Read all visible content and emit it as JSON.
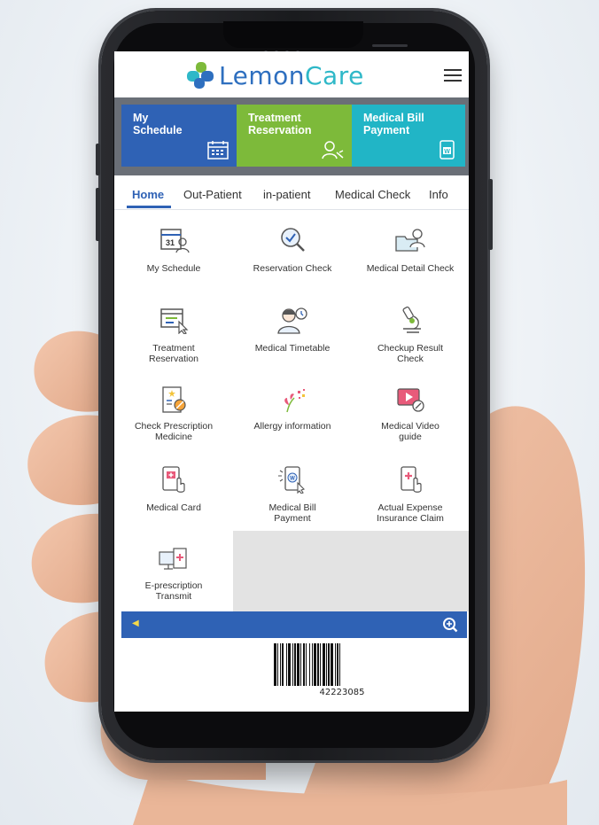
{
  "app": {
    "logo_lemon": "Lemon",
    "logo_care": "Care",
    "menu_icon": "hamburger-menu-icon"
  },
  "quick_tiles": [
    {
      "line1": "My",
      "line2": "Schedule",
      "icon": "calendar-icon",
      "color": "#2f62b5"
    },
    {
      "line1": "Treatment",
      "line2": "Reservation",
      "icon": "doctor-icon",
      "color": "#7dba3a"
    },
    {
      "line1": "Medical Bill",
      "line2": "Payment",
      "icon": "bill-icon",
      "color": "#21b5c6"
    }
  ],
  "nav": {
    "tabs": [
      "Home",
      "Out-Patient",
      "in-patient",
      "Medical Check",
      "Info"
    ],
    "active": "Home"
  },
  "menu": [
    {
      "label": "My Schedule",
      "icon": "calendar-31-icon"
    },
    {
      "label": "Reservation Check",
      "icon": "magnifier-check-icon"
    },
    {
      "label": "Medical Detail Check",
      "icon": "folder-person-icon"
    },
    {
      "label_1": "Treatment",
      "label_2": "Reservation",
      "icon": "calendar-cursor-icon"
    },
    {
      "label": "Medical Timetable",
      "icon": "doctor-clock-icon"
    },
    {
      "label_1": "Checkup Result",
      "label_2": "Check",
      "icon": "microscope-icon"
    },
    {
      "label_1": "Check Prescription",
      "label_2": "Medicine",
      "icon": "prescription-icon"
    },
    {
      "label": "Allergy information",
      "icon": "flower-allergy-icon"
    },
    {
      "label_1": "Medical Video",
      "label_2": "guide",
      "icon": "video-play-icon"
    },
    {
      "label": "Medical Card",
      "icon": "medical-card-icon"
    },
    {
      "label_1": "Medical Bill",
      "label_2": "Payment",
      "icon": "phone-bill-icon"
    },
    {
      "label_1": "Actual Expense",
      "label_2": "Insurance Claim",
      "icon": "phone-claim-icon"
    },
    {
      "label_1": "E-prescription",
      "label_2": "Transmit",
      "icon": "monitor-prescription-icon"
    }
  ],
  "barcode": {
    "number": "42223085",
    "zoom_icon": "zoom-in-icon",
    "arrow_icon": "left-arrow-icon"
  },
  "colors": {
    "primary_blue": "#2f62b5",
    "green": "#7dba3a",
    "teal": "#21b5c6"
  }
}
